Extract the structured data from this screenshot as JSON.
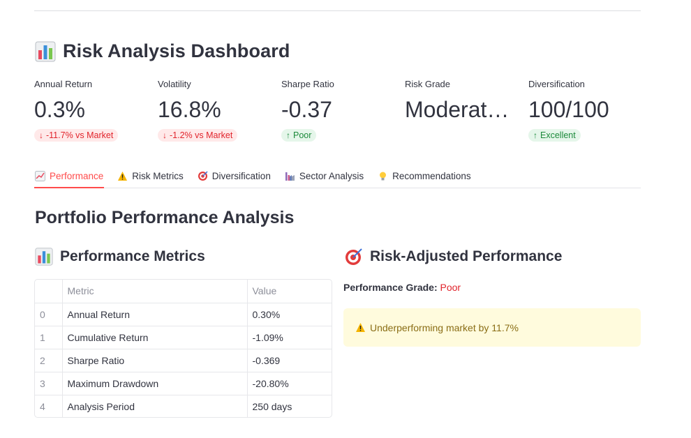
{
  "dashboard": {
    "icon": "bar-chart-icon",
    "title": "Risk Analysis Dashboard"
  },
  "metrics": [
    {
      "label": "Annual Return",
      "value": "0.3%",
      "delta": "-11.7% vs Market",
      "direction": "down"
    },
    {
      "label": "Volatility",
      "value": "16.8%",
      "delta": "-1.2% vs Market",
      "direction": "down"
    },
    {
      "label": "Sharpe Ratio",
      "value": "-0.37",
      "delta": "Poor",
      "direction": "up"
    },
    {
      "label": "Risk Grade",
      "value": "Moderat…",
      "delta": "",
      "direction": ""
    },
    {
      "label": "Diversification",
      "value": "100/100",
      "delta": "Excellent",
      "direction": "up"
    }
  ],
  "tabs": [
    {
      "label": "Performance",
      "icon": "line-chart-icon",
      "active": true
    },
    {
      "label": "Risk Metrics",
      "icon": "warning-icon",
      "active": false
    },
    {
      "label": "Diversification",
      "icon": "target-icon",
      "active": false
    },
    {
      "label": "Sector Analysis",
      "icon": "factory-icon",
      "active": false
    },
    {
      "label": "Recommendations",
      "icon": "lightbulb-icon",
      "active": false
    }
  ],
  "section_title": "Portfolio Performance Analysis",
  "perf_metrics": {
    "title": "Performance Metrics",
    "columns": [
      "",
      "Metric",
      "Value"
    ],
    "rows": [
      [
        "0",
        "Annual Return",
        "0.30%"
      ],
      [
        "1",
        "Cumulative Return",
        "-1.09%"
      ],
      [
        "2",
        "Sharpe Ratio",
        "-0.369"
      ],
      [
        "3",
        "Maximum Drawdown",
        "-20.80%"
      ],
      [
        "4",
        "Analysis Period",
        "250 days"
      ]
    ]
  },
  "risk_adjusted": {
    "title": "Risk-Adjusted Performance",
    "grade_label": "Performance Grade:",
    "grade_value": "Poor",
    "warning": "Underperforming market by 11.7%"
  },
  "colors": {
    "accent": "#ff4b4b",
    "negative": "#e1242c",
    "positive": "#1c8a3b",
    "warning_bg": "#fffbdd",
    "warning_text": "#8a6d15"
  }
}
